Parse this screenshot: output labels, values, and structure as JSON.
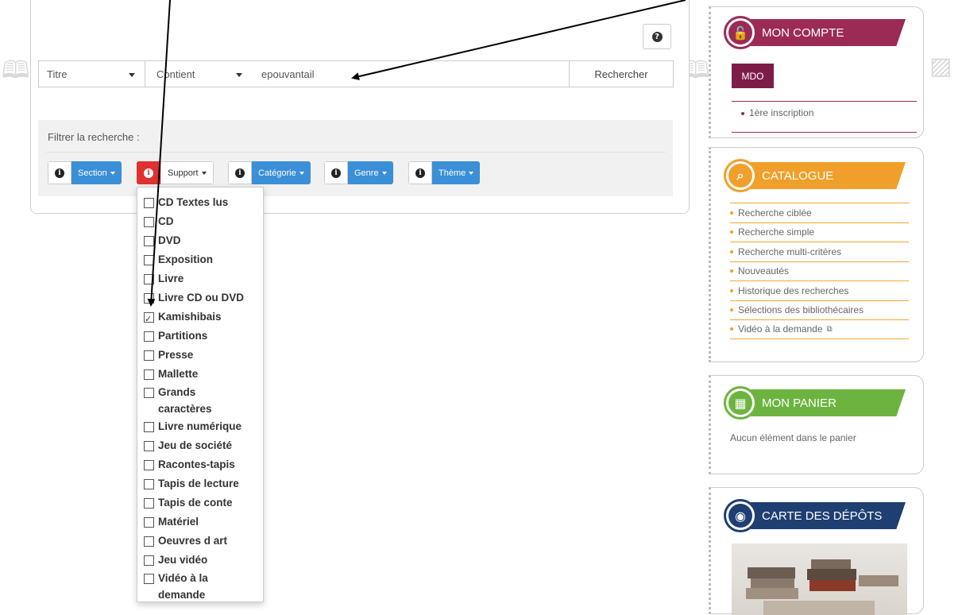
{
  "search": {
    "help_icon": "question-icon",
    "field_value": "Titre",
    "operator_value": "Contient",
    "query": "epouvantail",
    "submit_label": "Rechercher",
    "filter_label": "Filtrer la recherche :"
  },
  "filters": [
    {
      "label": "Section"
    },
    {
      "label": "Support"
    },
    {
      "label": "Catégorie"
    },
    {
      "label": "Genre"
    },
    {
      "label": "Thème"
    }
  ],
  "support_options": [
    {
      "label": "CD Textes lus",
      "checked": false
    },
    {
      "label": "CD",
      "checked": false
    },
    {
      "label": "DVD",
      "checked": false
    },
    {
      "label": "Exposition",
      "checked": false
    },
    {
      "label": "Livre",
      "checked": false
    },
    {
      "label": "Livre CD ou DVD",
      "checked": false
    },
    {
      "label": "Kamishibais",
      "checked": true
    },
    {
      "label": "Partitions",
      "checked": false
    },
    {
      "label": "Presse",
      "checked": false
    },
    {
      "label": "Mallette",
      "checked": false
    },
    {
      "label": "Grands caractères",
      "checked": false
    },
    {
      "label": "Livre numérique",
      "checked": false
    },
    {
      "label": "Jeu de société",
      "checked": false
    },
    {
      "label": "Racontes-tapis",
      "checked": false
    },
    {
      "label": "Tapis de lecture",
      "checked": false
    },
    {
      "label": "Tapis de conte",
      "checked": false
    },
    {
      "label": "Matériel",
      "checked": false
    },
    {
      "label": "Oeuvres d art",
      "checked": false
    },
    {
      "label": "Jeu vidéo",
      "checked": false
    },
    {
      "label": "Vidéo à la demande",
      "checked": false
    }
  ],
  "sidebar": {
    "account": {
      "title": "MON COMPTE",
      "color": "#9b2a55",
      "button": "MDO",
      "link": "1ère inscription"
    },
    "catalog": {
      "title": "CATALOGUE",
      "color": "#f0a02a",
      "items": [
        "Recherche ciblée",
        "Recherche simple",
        "Recherche multi-critères",
        "Nouveautés",
        "Historique des recherches",
        "Sélections des bibliothécaires",
        "Vidéo à la demande"
      ]
    },
    "cart": {
      "title": "MON PANIER",
      "color": "#6cb43f",
      "empty": "Aucun élément dans le panier"
    },
    "map": {
      "title": "CARTE DES DÉPÔTS",
      "color": "#1f3f73"
    }
  }
}
